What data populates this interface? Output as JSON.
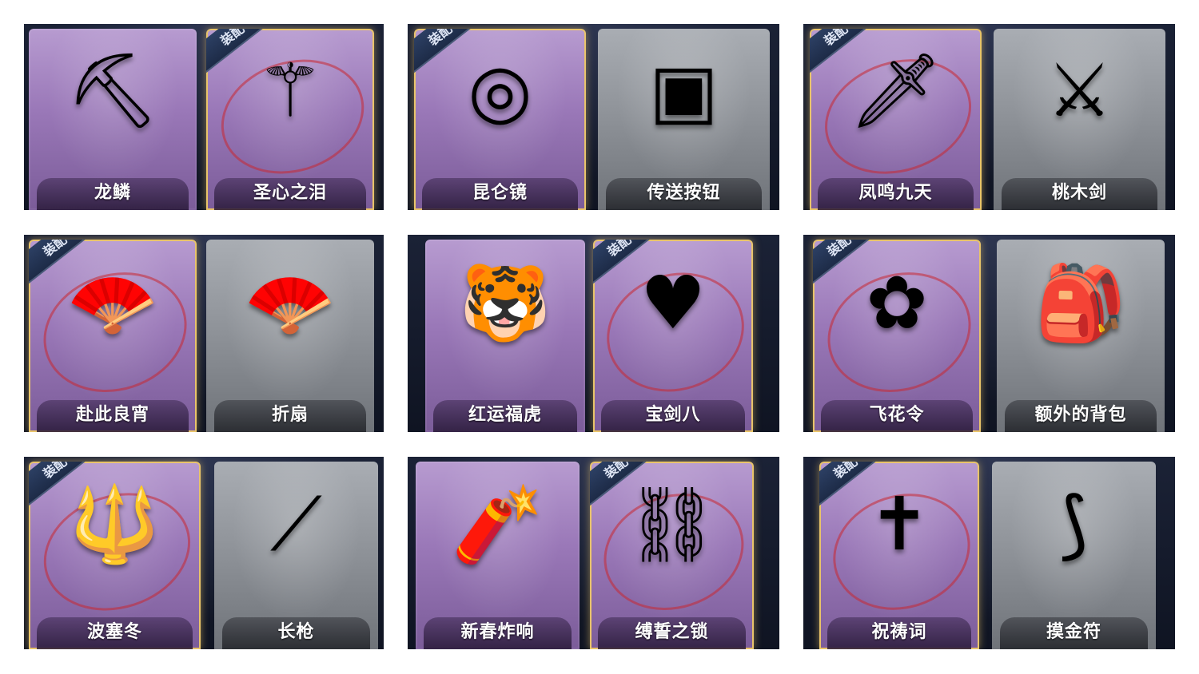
{
  "equipped_badge": "装配",
  "panels": [
    {
      "left": {
        "label": "龙鳞",
        "icon": "golden-shovel-icon",
        "glyph": "⛏",
        "variant": "purple",
        "equipped": false,
        "ring": false
      },
      "right": {
        "label": "圣心之泪",
        "icon": "heart-scepter-icon",
        "glyph": "⚚",
        "variant": "purple",
        "equipped": true,
        "ring": true
      }
    },
    {
      "left": {
        "label": "昆仑镜",
        "icon": "ornate-mirror-icon",
        "glyph": "◎",
        "variant": "purple",
        "equipped": true,
        "ring": false
      },
      "right": {
        "label": "传送按钮",
        "icon": "teleport-remote-icon",
        "glyph": "▣",
        "variant": "gray",
        "equipped": false,
        "ring": false
      }
    },
    {
      "left": {
        "label": "凤鸣九天",
        "icon": "crimson-sword-icon",
        "glyph": "🗡",
        "variant": "purple",
        "equipped": true,
        "ring": true
      },
      "right": {
        "label": "桃木剑",
        "icon": "wooden-sword-icon",
        "glyph": "⚔",
        "variant": "gray",
        "equipped": false,
        "ring": false
      }
    },
    {
      "left": {
        "label": "赴此良宵",
        "icon": "ornate-fan-icon",
        "glyph": "🪭",
        "variant": "purple",
        "equipped": true,
        "ring": true
      },
      "right": {
        "label": "折扇",
        "icon": "folding-fan-icon",
        "glyph": "🪭",
        "variant": "gray",
        "equipped": false,
        "ring": false
      }
    },
    {
      "left": {
        "label": "红运福虎",
        "icon": "tiger-pillow-icon",
        "glyph": "🐯",
        "variant": "purple",
        "equipped": false,
        "ring": false
      },
      "right": {
        "label": "宝剑八",
        "icon": "heart-shield-icon",
        "glyph": "♥",
        "variant": "purple",
        "equipped": true,
        "ring": true
      }
    },
    {
      "left": {
        "label": "飞花令",
        "icon": "flower-bouquet-icon",
        "glyph": "✿",
        "variant": "purple",
        "equipped": true,
        "ring": true
      },
      "right": {
        "label": "额外的背包",
        "icon": "backpack-icon",
        "glyph": "🎒",
        "variant": "gray",
        "equipped": false,
        "ring": false
      }
    },
    {
      "left": {
        "label": "波塞冬",
        "icon": "trident-staff-icon",
        "glyph": "🔱",
        "variant": "purple",
        "equipped": true,
        "ring": true
      },
      "right": {
        "label": "长枪",
        "icon": "spear-icon",
        "glyph": "⟋",
        "variant": "gray",
        "equipped": false,
        "ring": false
      }
    },
    {
      "left": {
        "label": "新春炸响",
        "icon": "firecracker-string-icon",
        "glyph": "🧨",
        "variant": "purple",
        "equipped": false,
        "ring": false
      },
      "right": {
        "label": "缚誓之锁",
        "icon": "chain-scepter-icon",
        "glyph": "⛓",
        "variant": "purple",
        "equipped": true,
        "ring": true
      }
    },
    {
      "left": {
        "label": "祝祷词",
        "icon": "cross-pendant-icon",
        "glyph": "✝",
        "variant": "purple",
        "equipped": true,
        "ring": true
      },
      "right": {
        "label": "摸金符",
        "icon": "tooth-amulet-icon",
        "glyph": "⟆",
        "variant": "gray",
        "equipped": false,
        "ring": false
      }
    }
  ]
}
